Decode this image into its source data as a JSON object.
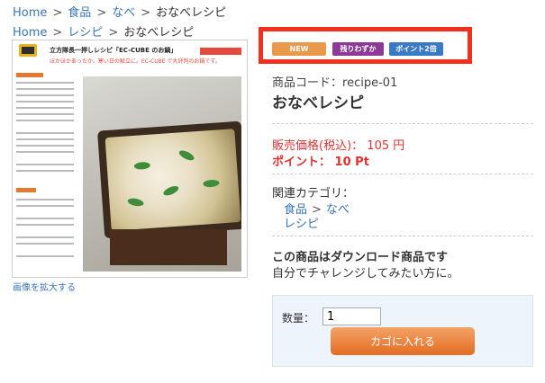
{
  "breadcrumbs": [
    {
      "home": "Home",
      "cat": "食品",
      "sub": "なべ",
      "current": "おなべレシピ"
    },
    {
      "home": "Home",
      "cat": "レシピ",
      "current": "おなべレシピ"
    }
  ],
  "image": {
    "title_text": "立方隊長一押しレシピ「EC-CUBE のお鍋」",
    "subtitle_text": "ほかほかあったか、寒い日の献立に。EC-CUBE で大評判のお鍋です。",
    "enlarge_link": "画像を拡大する"
  },
  "badges": {
    "new": "NEW",
    "few_left": "残りわずか",
    "point_double": "ポイント2倍"
  },
  "product": {
    "code_label": "商品コード：",
    "code_value": "recipe-01",
    "name": "おなべレシピ",
    "price_label": "販売価格(税込)：",
    "price_value": "105 円",
    "point_label": "ポイント：",
    "point_value": "10 Pt"
  },
  "category": {
    "label": "関連カテゴリ：",
    "path1": {
      "a": "食品",
      "b": "なべ"
    },
    "path2": "レシピ"
  },
  "download": {
    "title": "この商品はダウンロード商品です",
    "desc": "自分でチャレンジしてみたい方に。"
  },
  "cart": {
    "qty_label": "数量：",
    "qty_value": "1",
    "button": "カゴに入れる"
  },
  "colors": {
    "accent_red": "#f2301e",
    "price_red": "#dd3333",
    "link_blue": "#3a76b5",
    "cart_orange": "#e26d22"
  }
}
